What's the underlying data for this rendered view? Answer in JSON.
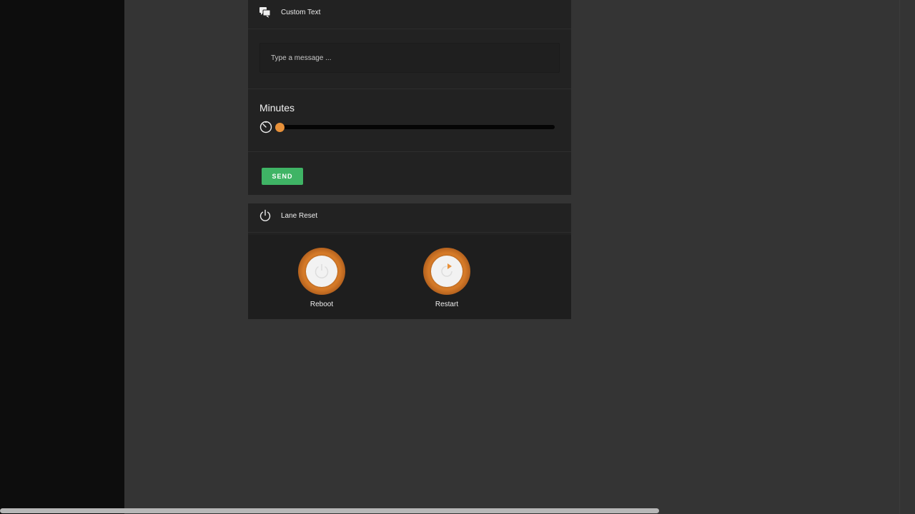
{
  "custom_text": {
    "title": "Custom Text",
    "message_placeholder": "Type a message ...",
    "message_value": "",
    "minutes_label": "Minutes",
    "minutes_slider_value": 0,
    "minutes_slider_max": 1,
    "send_label": "SEND"
  },
  "lane_reset": {
    "title": "Lane Reset",
    "reboot_label": "Reboot",
    "restart_label": "Restart"
  },
  "colors": {
    "accent_orange": "#e8913a",
    "send_green": "#3fb465"
  },
  "icons": {
    "custom_text": "chat-bubbles-icon",
    "minutes": "timer-icon",
    "lane_reset": "power-icon",
    "reboot": "power-icon",
    "restart": "restart-icon"
  }
}
